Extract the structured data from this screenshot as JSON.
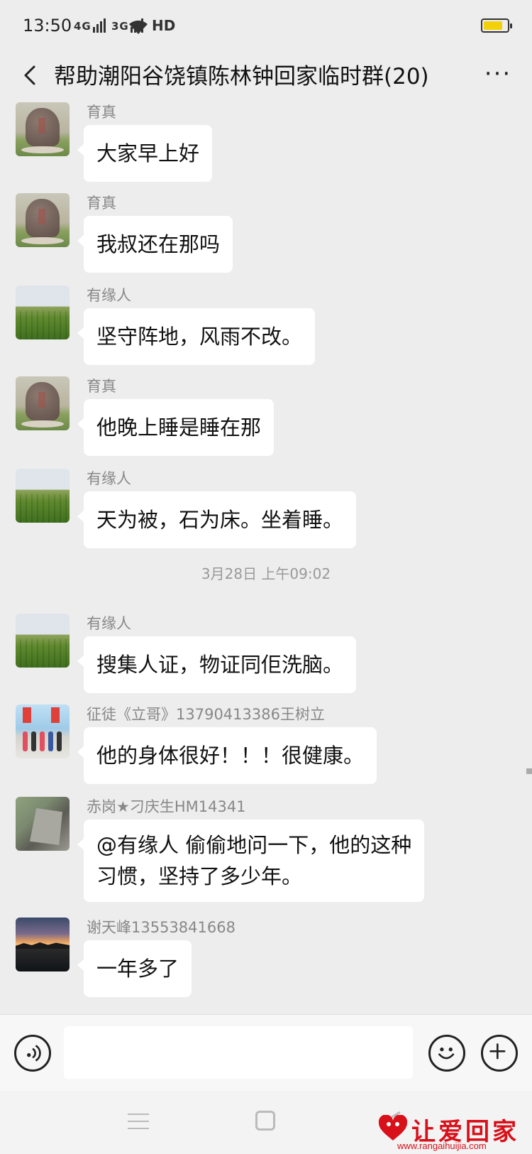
{
  "status_bar": {
    "time": "13:50",
    "network": "4G",
    "network2": "3G",
    "hd": "HD",
    "battery_color": "#f2d10b"
  },
  "header": {
    "title": "帮助潮阳谷饶镇陈林钟回家临时群(20)",
    "back_icon": "chevron-left-icon",
    "more_label": "···"
  },
  "messages": [
    {
      "sender": "育真",
      "text": "大家早上好",
      "avatar": "stone"
    },
    {
      "sender": "育真",
      "text": "我叔还在那吗",
      "avatar": "stone"
    },
    {
      "sender": "有缘人",
      "text": "坚守阵地，风雨不改。",
      "avatar": "field"
    },
    {
      "sender": "育真",
      "text": "他晚上睡是睡在那",
      "avatar": "stone"
    },
    {
      "sender": "有缘人",
      "text": "天为被，石为床。坐着睡。",
      "avatar": "field"
    },
    {
      "sender": "有缘人",
      "text": "搜集人证，物证同佢洗脑。",
      "avatar": "field"
    },
    {
      "sender": "征徒《立哥》13790413386王树立",
      "text": "他的身体很好！！！很健康。",
      "avatar": "people"
    },
    {
      "sender": "赤岗★刁庆生HM14341",
      "text_line1": "@有缘人  偷偷地问一下，他的这种",
      "text_line2": "习惯，坚持了多少年。",
      "avatar": "rock"
    },
    {
      "sender": "谢天峰13553841668",
      "text": "一年多了",
      "avatar": "sunset"
    }
  ],
  "timestamp": "3月28日 上午09:02",
  "input": {
    "placeholder": "",
    "voice_icon": "voice-icon",
    "emoji_icon": "emoji-icon",
    "add_icon": "plus-icon"
  },
  "watermark": {
    "text": "让爱回家",
    "url": "www.rangaihuijia.com",
    "color": "#d8101a"
  }
}
